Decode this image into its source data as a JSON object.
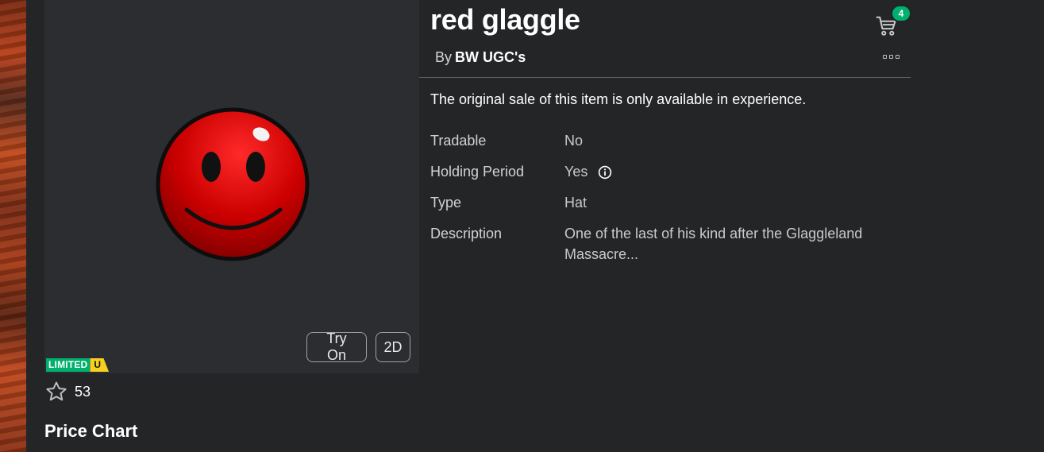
{
  "item": {
    "title": "red glaggle",
    "by_prefix": "By",
    "creator": "BW UGC's",
    "notice": "The original sale of this item is only available in experience."
  },
  "thumbnail": {
    "try_on_label": "Try On",
    "view_2d_label": "2D",
    "limited_label": "LIMITED",
    "limited_u_label": "U",
    "limited_colors": {
      "green": "#00b06f",
      "yellow": "#f5d020"
    }
  },
  "favorites": {
    "count": "53",
    "icon": "star-outline-icon"
  },
  "cart": {
    "count": "4",
    "icon": "cart-icon",
    "badge_color": "#00b06f"
  },
  "menu": {
    "icon": "more-options-icon"
  },
  "details": [
    {
      "label": "Tradable",
      "value": "No"
    },
    {
      "label": "Holding Period",
      "value": "Yes",
      "icon": "info-icon"
    },
    {
      "label": "Type",
      "value": "Hat"
    },
    {
      "label": "Description",
      "value": "One of the last of his kind after the Glaggleland Massacre..."
    }
  ],
  "sections": {
    "price_chart_title": "Price Chart"
  },
  "colors": {
    "background": "#232527",
    "panel": "#2b2d30",
    "accent": "#00b06f"
  }
}
